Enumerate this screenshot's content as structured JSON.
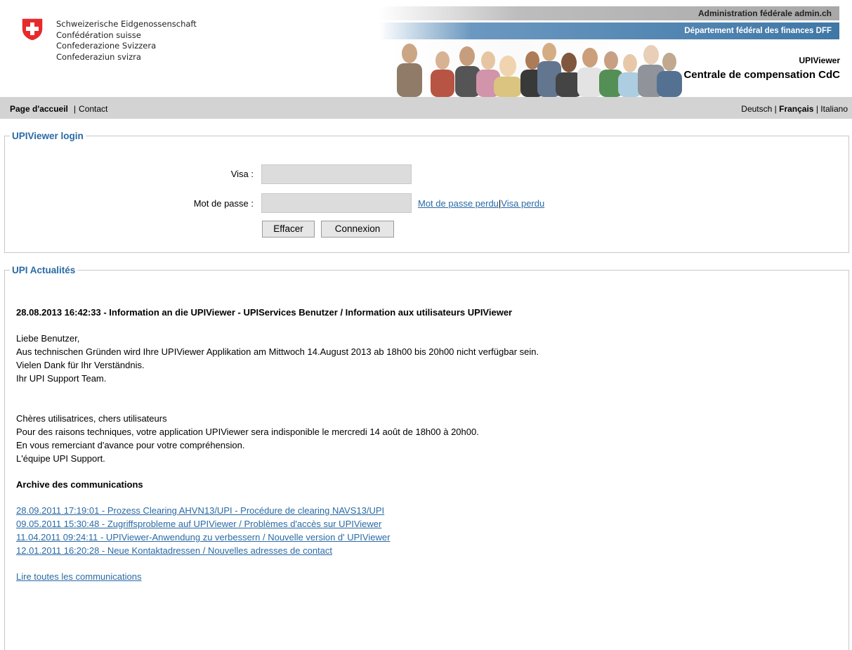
{
  "header": {
    "confederation_lines": [
      "Schweizerische Eidgenossenschaft",
      "Confédération suisse",
      "Confederazione Svizzera",
      "Confederaziun svizra"
    ],
    "admin": "Administration fédérale admin.ch",
    "department": "Département fédéral des finances DFF",
    "app_name": "UPIViewer",
    "app_subtitle": "Centrale de compensation CdC"
  },
  "nav": {
    "home": "Page d'accueil",
    "separator": "|",
    "contact": "Contact",
    "languages": [
      "Deutsch",
      "Français",
      "Italiano"
    ],
    "current_language": "Français"
  },
  "login": {
    "legend": "UPIViewer login",
    "visa_label": "Visa :",
    "visa_value": "",
    "password_label": "Mot de passe :",
    "password_value": "",
    "lost_password": "Mot de passe perdu",
    "lost_visa": "Visa perdu",
    "clear_button": "Effacer",
    "submit_button": "Connexion"
  },
  "news": {
    "legend": "UPI Actualités",
    "headline": "28.08.2013 16:42:33 - Information an die UPIViewer - UPIServices Benutzer / Information aux utilisateurs UPIViewer",
    "german_lines": [
      "Liebe Benutzer,",
      "Aus technischen Gründen wird  Ihre UPIViewer Applikation am Mittwoch 14.August 2013 ab 18h00 bis 20h00 nicht verfügbar sein.",
      "Vielen Dank für Ihr Verständnis.",
      "Ihr UPI Support Team."
    ],
    "french_lines": [
      "Chères utilisatrices, chers utilisateurs",
      "Pour des raisons techniques, votre application UPIViewer sera indisponible le mercredi 14 août de 18h00 à 20h00.",
      "En vous remerciant d'avance pour votre compréhension.",
      "L'équipe UPI Support."
    ],
    "archive_title": "Archive des communications",
    "archive_links": [
      "28.09.2011 17:19:01 - Prozess Clearing AHVN13/UPI - Procédure de clearing NAVS13/UPI",
      "09.05.2011 15:30:48 - Zugriffsprobleme auf UPIViewer / Problèmes d'accès sur UPIViewer",
      "11.04.2011 09:24:11 - UPIViewer-Anwendung zu verbessern / Nouvelle version d' UPIViewer",
      "12.01.2011 16:20:28 - Neue Kontaktadressen / Nouvelles adresses de contact"
    ],
    "all_link": "Lire toutes les communications"
  },
  "colors": {
    "link": "#2a6aa5",
    "legend": "#2a6aa5",
    "navbar": "#d3d3d3",
    "department_bar": "#3f77a6",
    "swiss_red": "#e8292b"
  }
}
